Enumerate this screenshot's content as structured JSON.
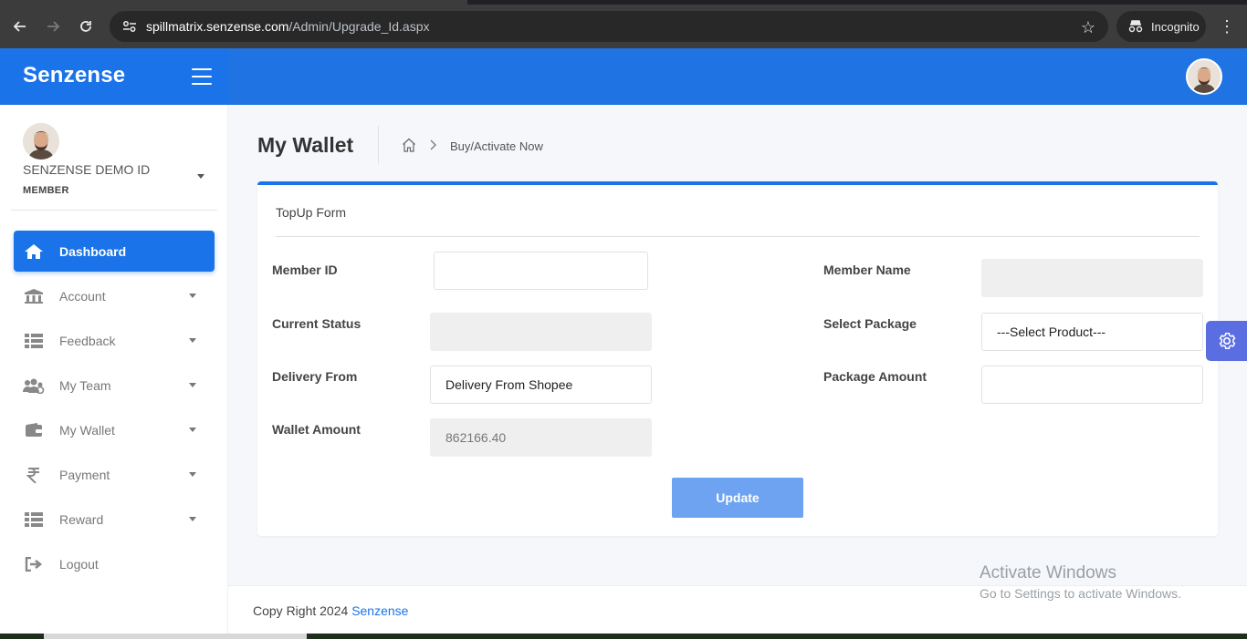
{
  "browser": {
    "url_domain": "spillmatrix.senzense.com",
    "url_path": "/Admin/Upgrade_Id.aspx",
    "incognito_label": "Incognito"
  },
  "header": {
    "brand": "Senzense"
  },
  "sidebar": {
    "profile_name": "SENZENSE DEMO ID",
    "profile_role": "MEMBER",
    "items": [
      {
        "label": "Dashboard",
        "icon": "home-icon"
      },
      {
        "label": "Account",
        "icon": "bank-icon"
      },
      {
        "label": "Feedback",
        "icon": "list-icon"
      },
      {
        "label": "My Team",
        "icon": "users-icon"
      },
      {
        "label": "My Wallet",
        "icon": "wallet-icon"
      },
      {
        "label": "Payment",
        "icon": "rupee-icon"
      },
      {
        "label": "Reward",
        "icon": "list-icon"
      },
      {
        "label": "Logout",
        "icon": "logout-icon"
      }
    ]
  },
  "main": {
    "page_title": "My Wallet",
    "breadcrumb_current": "Buy/Activate Now",
    "card_title": "TopUp Form",
    "fields": {
      "member_id": {
        "label": "Member ID",
        "value": ""
      },
      "member_name": {
        "label": "Member Name",
        "value": ""
      },
      "current_status": {
        "label": "Current Status",
        "value": ""
      },
      "select_package": {
        "label": "Select Package",
        "value": "---Select Product---"
      },
      "delivery_from": {
        "label": "Delivery From",
        "value": "Delivery From Shopee"
      },
      "package_amount": {
        "label": "Package Amount",
        "value": ""
      },
      "wallet_amount": {
        "label": "Wallet Amount",
        "value": "862166.40"
      }
    },
    "update_label": "Update"
  },
  "footer": {
    "copyright_prefix": "Copy Right 2024 ",
    "copyright_link": "Senzense"
  },
  "windows": {
    "activate_title": "Activate Windows",
    "activate_sub": "Go to Settings to activate Windows."
  },
  "colors": {
    "primary": "#1a73e8",
    "button": "#6da3f0",
    "settings_tab": "#5b6ee1"
  }
}
